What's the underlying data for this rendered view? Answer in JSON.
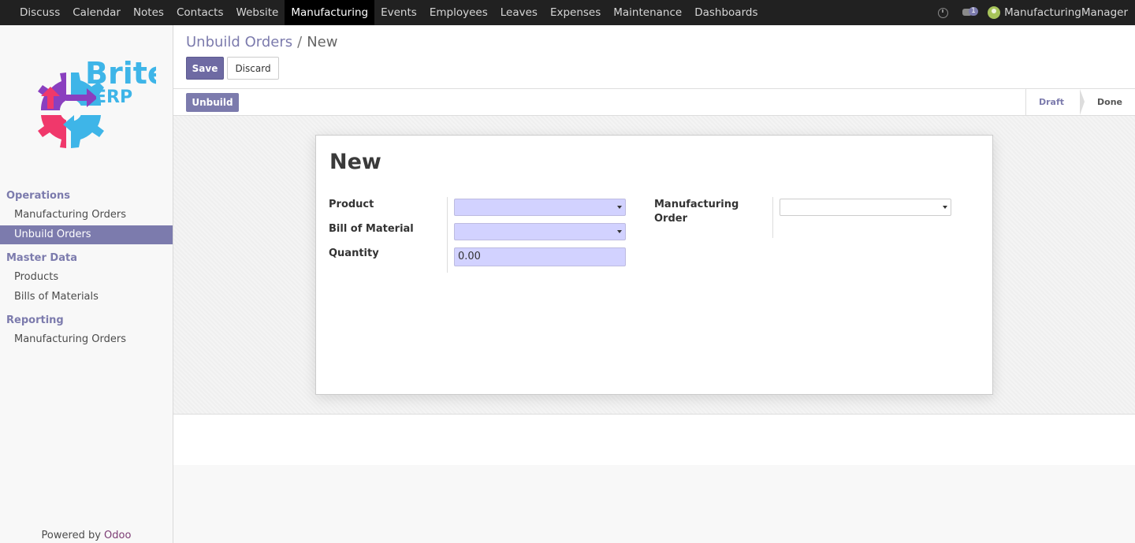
{
  "topbar": {
    "menu": [
      "Discuss",
      "Calendar",
      "Notes",
      "Contacts",
      "Website",
      "Manufacturing",
      "Events",
      "Employees",
      "Leaves",
      "Expenses",
      "Maintenance",
      "Dashboards"
    ],
    "active": "Manufacturing",
    "chat_badge": "1",
    "user": "ManufacturingManager",
    "icons": [
      "clock-icon",
      "chat-icon",
      "avatar"
    ]
  },
  "sidebar": {
    "logo_text_1": "Brite",
    "logo_text_2": "ERP",
    "sections": [
      {
        "title": "Operations",
        "items": [
          "Manufacturing Orders",
          "Unbuild Orders"
        ]
      },
      {
        "title": "Master Data",
        "items": [
          "Products",
          "Bills of Materials"
        ]
      },
      {
        "title": "Reporting",
        "items": [
          "Manufacturing Orders"
        ]
      }
    ],
    "active_item": "Unbuild Orders",
    "powered_prefix": "Powered by ",
    "powered_brand": "Odoo"
  },
  "control": {
    "breadcrumb_parent": "Unbuild Orders",
    "breadcrumb_sep": "/",
    "breadcrumb_current": "New",
    "save_label": "Save",
    "discard_label": "Discard"
  },
  "status": {
    "unbuild_label": "Unbuild",
    "stages": [
      "Draft",
      "Done"
    ],
    "current_stage": "Draft"
  },
  "form": {
    "title": "New",
    "product_label": "Product",
    "product_value": "",
    "bom_label": "Bill of Material",
    "bom_value": "",
    "quantity_label": "Quantity",
    "quantity_value": "0.00",
    "mo_label_1": "Manufacturing",
    "mo_label_2": "Order",
    "mo_value": ""
  },
  "colors": {
    "accent": "#7c7bad",
    "topbar": "#212121",
    "required_field": "#d2d2ff"
  }
}
